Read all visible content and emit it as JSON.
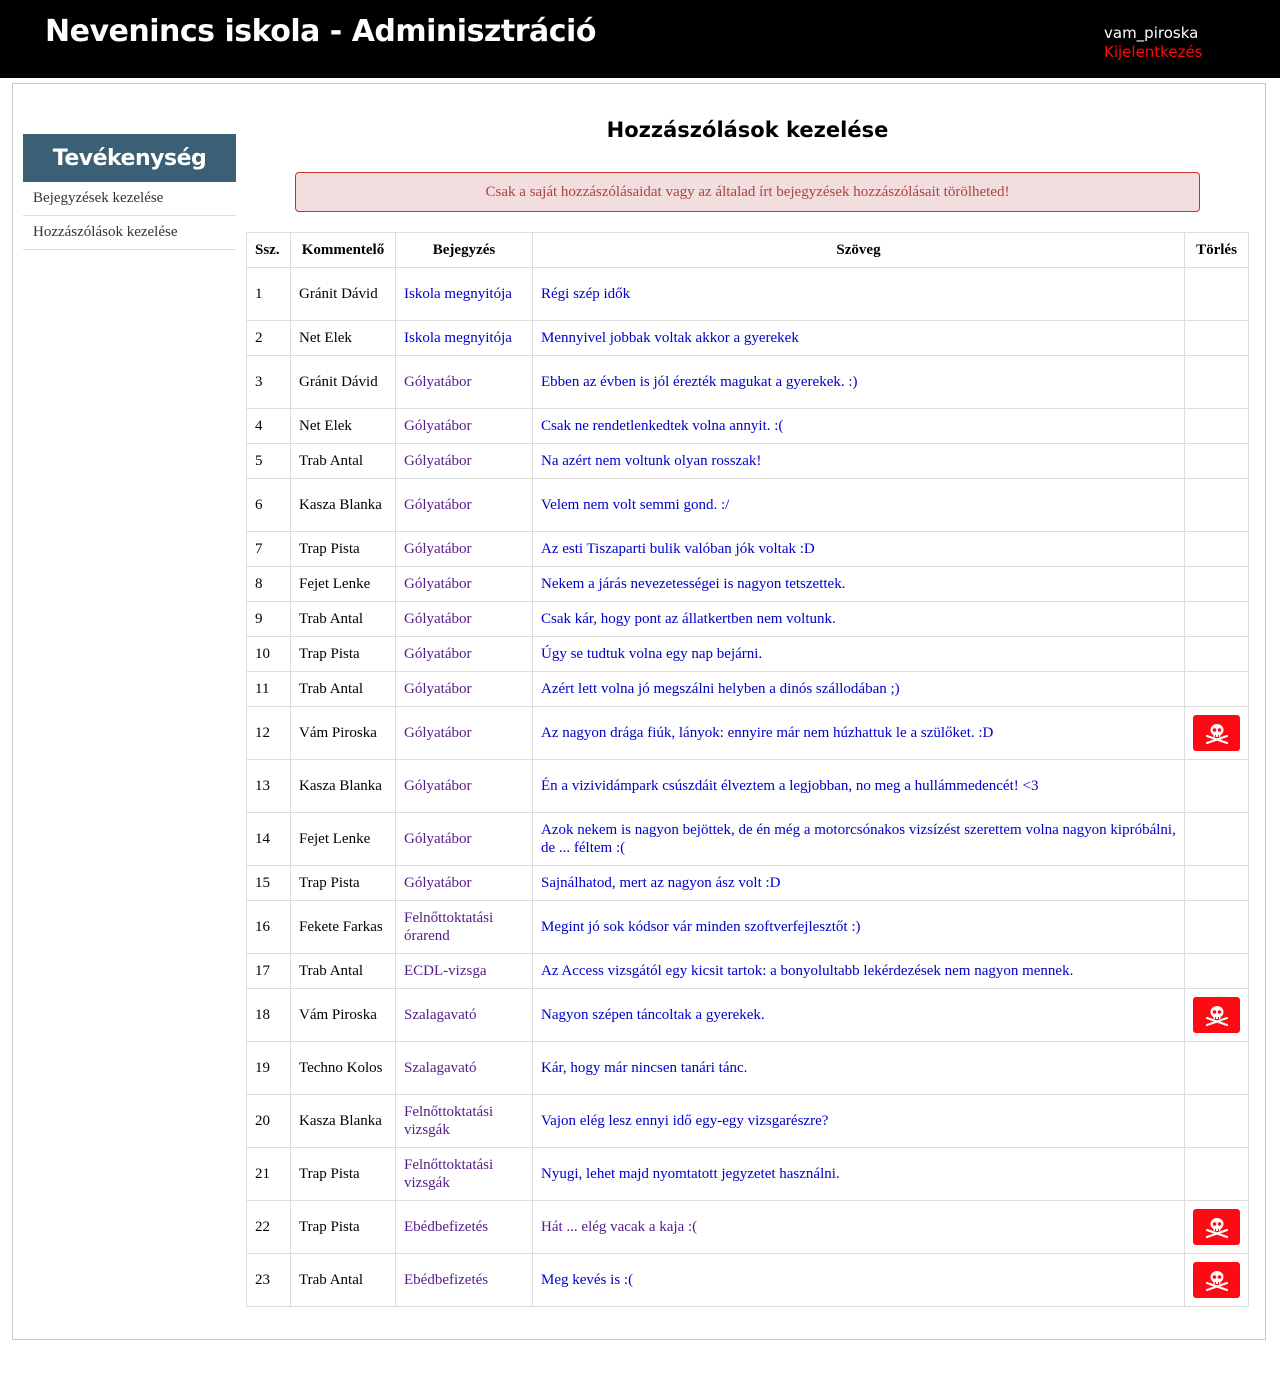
{
  "header": {
    "title": "Nevenincs iskola - Adminisztráció",
    "username": "vam_piroska",
    "logout_label": "Kijelentkezés"
  },
  "sidebar": {
    "title": "Tevékenység",
    "items": [
      {
        "label": "Bejegyzések kezelése"
      },
      {
        "label": "Hozzászólások kezelése"
      }
    ]
  },
  "main": {
    "title": "Hozzászólások kezelése",
    "alert": "Csak a saját hozzászólásaidat vagy az általad írt bejegyzések hozzászólásait törölheted!"
  },
  "colors": {
    "topbar": "#000000",
    "sidebar_header": "#3b5f74",
    "logout": "#ff0a0a",
    "alert_bg": "#f2dede",
    "alert_text": "#a94442",
    "delete_button": "#ff0a14",
    "link": "#0000cc",
    "visited_link": "#551a8b"
  },
  "table": {
    "headers": [
      "Ssz.",
      "Kommentelő",
      "Bejegyzés",
      "Szöveg",
      "Törlés"
    ],
    "delete_icon": "skull-crossbones-icon",
    "rows": [
      {
        "no": "1",
        "author": "Gránit Dávid",
        "post": "Iskola megnyitója",
        "text": "Régi szép idők",
        "deletable": false,
        "post_visited": false,
        "text_visited": false
      },
      {
        "no": "2",
        "author": "Net Elek",
        "post": "Iskola megnyitója",
        "text": "Mennyivel jobbak voltak akkor a gyerekek",
        "deletable": false,
        "post_visited": false,
        "text_visited": false
      },
      {
        "no": "3",
        "author": "Gránit Dávid",
        "post": "Gólyatábor",
        "text": "Ebben az évben is jól érezték magukat a gyerekek. :)",
        "deletable": false,
        "post_visited": true,
        "text_visited": false
      },
      {
        "no": "4",
        "author": "Net Elek",
        "post": "Gólyatábor",
        "text": "Csak ne rendetlenkedtek volna annyit. :(",
        "deletable": false,
        "post_visited": true,
        "text_visited": false
      },
      {
        "no": "5",
        "author": "Trab Antal",
        "post": "Gólyatábor",
        "text": "Na azért nem voltunk olyan rosszak!",
        "deletable": false,
        "post_visited": true,
        "text_visited": false
      },
      {
        "no": "6",
        "author": "Kasza Blanka",
        "post": "Gólyatábor",
        "text": "Velem nem volt semmi gond. :/",
        "deletable": false,
        "post_visited": true,
        "text_visited": false
      },
      {
        "no": "7",
        "author": "Trap Pista",
        "post": "Gólyatábor",
        "text": "Az esti Tiszaparti bulik valóban jók voltak :D",
        "deletable": false,
        "post_visited": true,
        "text_visited": false
      },
      {
        "no": "8",
        "author": "Fejet Lenke",
        "post": "Gólyatábor",
        "text": "Nekem a járás nevezetességei is nagyon tetszettek.",
        "deletable": false,
        "post_visited": true,
        "text_visited": false
      },
      {
        "no": "9",
        "author": "Trab Antal",
        "post": "Gólyatábor",
        "text": "Csak kár, hogy pont az állatkertben nem voltunk.",
        "deletable": false,
        "post_visited": true,
        "text_visited": false
      },
      {
        "no": "10",
        "author": "Trap Pista",
        "post": "Gólyatábor",
        "text": "Úgy se tudtuk volna egy nap bejárni.",
        "deletable": false,
        "post_visited": true,
        "text_visited": false
      },
      {
        "no": "11",
        "author": "Trab Antal",
        "post": "Gólyatábor",
        "text": "Azért lett volna jó megszálni helyben a dinós szállodában ;)",
        "deletable": false,
        "post_visited": true,
        "text_visited": false
      },
      {
        "no": "12",
        "author": "Vám Piroska",
        "post": "Gólyatábor",
        "text": "Az nagyon drága fiúk, lányok: ennyire már nem húzhattuk le a szülőket. :D",
        "deletable": true,
        "post_visited": true,
        "text_visited": false
      },
      {
        "no": "13",
        "author": "Kasza Blanka",
        "post": "Gólyatábor",
        "text": "Én a vizividámpark csúszdáit élveztem a legjobban, no meg a hullámmedencét! <3",
        "deletable": false,
        "post_visited": true,
        "text_visited": false
      },
      {
        "no": "14",
        "author": "Fejet Lenke",
        "post": "Gólyatábor",
        "text": "Azok nekem is nagyon bejöttek, de én még a motorcsónakos vizsízést szerettem volna nagyon kipróbálni, de ... féltem :(",
        "deletable": false,
        "post_visited": true,
        "text_visited": false
      },
      {
        "no": "15",
        "author": "Trap Pista",
        "post": "Gólyatábor",
        "text": "Sajnálhatod, mert az nagyon ász volt :D",
        "deletable": false,
        "post_visited": true,
        "text_visited": false
      },
      {
        "no": "16",
        "author": "Fekete Farkas",
        "post": "Felnőttoktatási órarend",
        "text": "Megint jó sok kódsor vár minden szoftverfejlesztőt :)",
        "deletable": false,
        "post_visited": true,
        "text_visited": false
      },
      {
        "no": "17",
        "author": "Trab Antal",
        "post": "ECDL-vizsga",
        "text": "Az Access vizsgától egy kicsit tartok: a bonyolultabb lekérdezések nem nagyon mennek.",
        "deletable": false,
        "post_visited": true,
        "text_visited": false
      },
      {
        "no": "18",
        "author": "Vám Piroska",
        "post": "Szalagavató",
        "text": "Nagyon szépen táncoltak a gyerekek.",
        "deletable": true,
        "post_visited": true,
        "text_visited": false
      },
      {
        "no": "19",
        "author": "Techno Kolos",
        "post": "Szalagavató",
        "text": "Kár, hogy már nincsen tanári tánc.",
        "deletable": false,
        "post_visited": true,
        "text_visited": false
      },
      {
        "no": "20",
        "author": "Kasza Blanka",
        "post": "Felnőttoktatási vizsgák",
        "text": "Vajon elég lesz ennyi idő egy-egy vizsgarészre?",
        "deletable": false,
        "post_visited": true,
        "text_visited": false
      },
      {
        "no": "21",
        "author": "Trap Pista",
        "post": "Felnőttoktatási vizsgák",
        "text": "Nyugi, lehet majd nyomtatott jegyzetet használni.",
        "deletable": false,
        "post_visited": true,
        "text_visited": false
      },
      {
        "no": "22",
        "author": "Trap Pista",
        "post": "Ebédbefizetés",
        "text": "Hát ... elég vacak a kaja :(",
        "deletable": true,
        "post_visited": true,
        "text_visited": true
      },
      {
        "no": "23",
        "author": "Trab Antal",
        "post": "Ebédbefizetés",
        "text": "Meg kevés is :(",
        "deletable": true,
        "post_visited": true,
        "text_visited": false
      }
    ]
  }
}
